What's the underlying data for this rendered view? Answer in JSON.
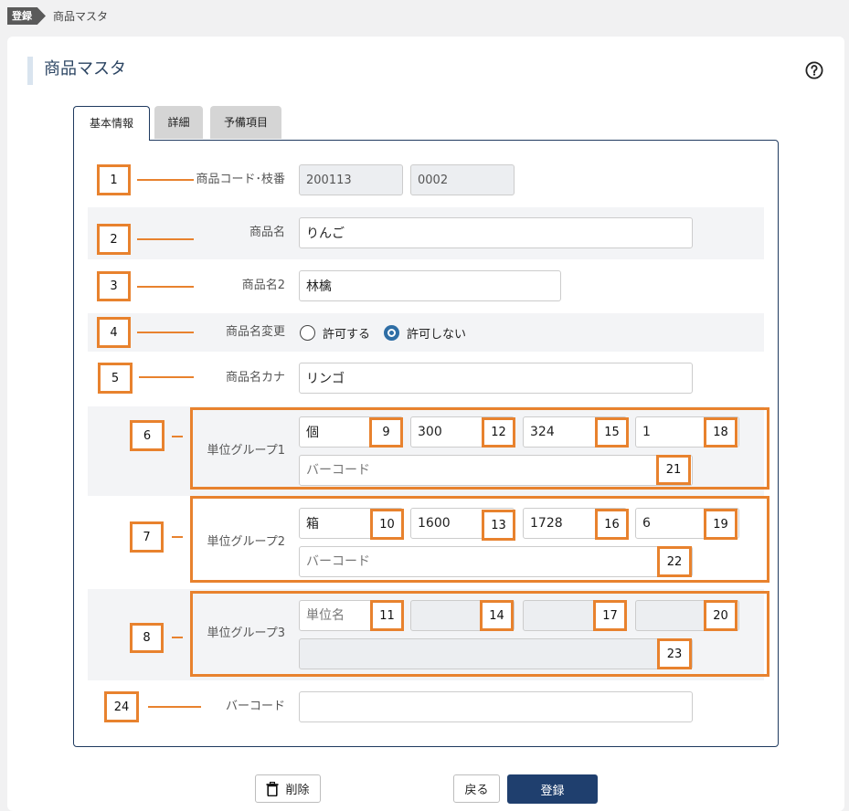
{
  "breadcrumb": {
    "badge": "登録",
    "current": "商品マスタ"
  },
  "header": {
    "title": "商品マスタ",
    "help_icon": "question-circle-icon"
  },
  "tabs": [
    {
      "label": "基本情報",
      "active": true
    },
    {
      "label": "詳細",
      "active": false
    },
    {
      "label": "予備項目",
      "active": false
    }
  ],
  "form": {
    "code": {
      "label": "商品コード･枝番",
      "code": "200113",
      "branch": "0002"
    },
    "name": {
      "label": "商品名",
      "value": "りんご"
    },
    "name2": {
      "label": "商品名2",
      "value": "林檎"
    },
    "name_change": {
      "label": "商品名変更",
      "options": [
        {
          "label": "許可する",
          "checked": false
        },
        {
          "label": "許可しない",
          "checked": true
        }
      ]
    },
    "kana": {
      "label": "商品名カナ",
      "value": "リンゴ"
    },
    "unit_groups": [
      {
        "label": "単位グループ1",
        "fields": [
          "個",
          "300",
          "324",
          "1"
        ],
        "barcode": "",
        "barcode_placeholder": "バーコード"
      },
      {
        "label": "単位グループ2",
        "fields": [
          "箱",
          "1600",
          "1728",
          "6"
        ],
        "barcode": "",
        "barcode_placeholder": "バーコード"
      },
      {
        "label": "単位グループ3",
        "fields": [
          "",
          "",
          "",
          ""
        ],
        "unit_placeholder": "単位名",
        "barcode": ""
      }
    ],
    "barcode": {
      "label": "バーコード",
      "value": ""
    }
  },
  "annotations": [
    "1",
    "2",
    "3",
    "4",
    "5",
    "6",
    "7",
    "8",
    "9",
    "10",
    "11",
    "12",
    "13",
    "14",
    "15",
    "16",
    "17",
    "18",
    "19",
    "20",
    "21",
    "22",
    "23",
    "24"
  ],
  "footer": {
    "delete_label": "削除",
    "delete_icon": "trash-icon",
    "back_label": "戻る",
    "register_label": "登録"
  },
  "colors": {
    "panel_border": "#1f3a5f",
    "primary_button": "#1f3f6e",
    "annotation": "#e8822e",
    "radio_checked": "#2f6ea5",
    "title_accent": "#d9e4ef"
  }
}
